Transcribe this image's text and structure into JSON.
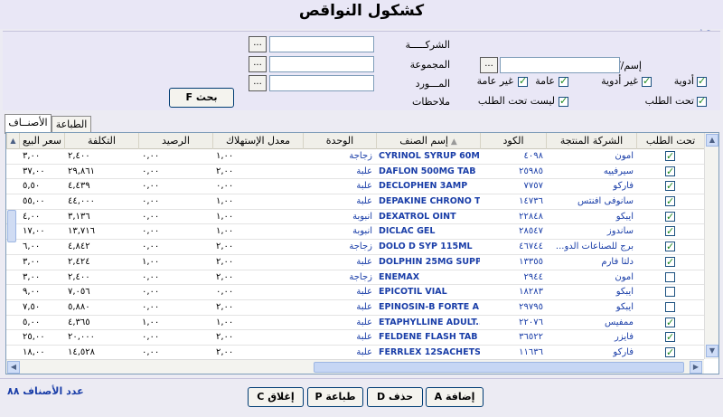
{
  "window": {
    "title": "كشكول النواقص"
  },
  "search": {
    "caption": "بحث",
    "company_label": "الشركـــــة",
    "group_label": "المجموعة",
    "supplier_label": "المـــورد",
    "notes_label": "ملاحظات",
    "item_label": "إسم/كود الصنف",
    "company_value": "",
    "group_value": "",
    "supplier_value": "",
    "item_value": "",
    "dots": "...",
    "search_button": "بحث F",
    "checks": {
      "medicines": {
        "label": "أدوية",
        "checked": true
      },
      "non_medicines": {
        "label": "غير أدوية",
        "checked": true
      },
      "public": {
        "label": "عامة",
        "checked": true
      },
      "non_public": {
        "label": "غير عامة",
        "checked": true
      },
      "on_order": {
        "label": "تحت الطلب",
        "checked": true
      },
      "not_on_order": {
        "label": "ليست تحت الطلب",
        "checked": true
      }
    }
  },
  "tabs": [
    {
      "label": "الأصنــاف",
      "active": true
    },
    {
      "label": "الطباعة",
      "active": false
    }
  ],
  "grid": {
    "columns": {
      "on_order": "تحت الطلب",
      "maker": "الشركة المنتجة",
      "code": "الكود",
      "name": "إسم الصنف",
      "unit": "الوحدة",
      "consumption": "معدل الإستهلاك",
      "balance": "الرصيد",
      "cost": "التكلفة",
      "price": "سعر البيع"
    },
    "rows": [
      {
        "checked": true,
        "maker": "امون",
        "code": "٤٠٩٨",
        "name": "CYRINOL SYRUP 60ML",
        "unit": "زجاجة",
        "consumption": "١,٠٠",
        "balance": "٠,٠٠",
        "cost": "٢,٤٠٠",
        "price": "٣,٠٠"
      },
      {
        "checked": true,
        "maker": "سيرفييه",
        "code": "٢٥٩٨٥",
        "name": "DAFLON 500MG TAB",
        "unit": "علبة",
        "consumption": "٢,٠٠",
        "balance": "٠,٠٠",
        "cost": "٢٩,٨٦١",
        "price": "٣٧,٠٠"
      },
      {
        "checked": true,
        "maker": "فاركو",
        "code": "٧٧٥٧",
        "name": "DECLOPHEN 3AMP",
        "unit": "علبة",
        "consumption": "٠,٠٠",
        "balance": "٠,٠٠",
        "cost": "٤,٤٣٩",
        "price": "٥,٥٠"
      },
      {
        "checked": true,
        "maker": "سانوفى افنتس",
        "code": "١٤٧٣٦",
        "name": "DEPAKINE CHRONO T...",
        "unit": "علبة",
        "consumption": "١,٠٠",
        "balance": "٠,٠٠",
        "cost": "٤٤,٠٠٠",
        "price": "٥٥,٠٠"
      },
      {
        "checked": true,
        "maker": "ايبكو",
        "code": "٢٢٨٤٨",
        "name": "DEXATROL OINT",
        "unit": "انبوبة",
        "consumption": "١,٠٠",
        "balance": "٠,٠٠",
        "cost": "٣,١٣٦",
        "price": "٤,٠٠"
      },
      {
        "checked": true,
        "maker": "ساندوز",
        "code": "٢٨٥٤٧",
        "name": "DICLAC GEL",
        "unit": "انبوبة",
        "consumption": "١,٠٠",
        "balance": "٠,٠٠",
        "cost": "١٣,٧١٦",
        "price": "١٧,٠٠"
      },
      {
        "checked": true,
        "maker": "برج للصناعات الدو...",
        "code": "٤٦٧٤٤",
        "name": "DOLO D SYP 115ML",
        "unit": "زجاجة",
        "consumption": "٢,٠٠",
        "balance": "٠,٠٠",
        "cost": "٤,٨٤٢",
        "price": "٦,٠٠"
      },
      {
        "checked": true,
        "maker": "دلتا فارم",
        "code": "١٣٣٥٥",
        "name": "DOLPHIN 25MG SUPP",
        "unit": "علبة",
        "consumption": "٢,٠٠",
        "balance": "١,٠٠",
        "cost": "٢,٤٢٤",
        "price": "٣,٠٠"
      },
      {
        "checked": false,
        "maker": "امون",
        "code": "٢٩٤٤",
        "name": "ENEMAX",
        "unit": "زجاجة",
        "consumption": "٢,٠٠",
        "balance": "٠,٠٠",
        "cost": "٢,٤٠٠",
        "price": "٣,٠٠"
      },
      {
        "checked": false,
        "maker": "ايبكو",
        "code": "١٨٢٨٣",
        "name": "EPICOTIL VIAL",
        "unit": "علبة",
        "consumption": "٠,٠٠",
        "balance": "٠,٠٠",
        "cost": "٧,٠٥٦",
        "price": "٩,٠٠"
      },
      {
        "checked": false,
        "maker": "ايبكو",
        "code": "٢٩٧٩٥",
        "name": "EPINOSIN-B FORTE A...",
        "unit": "علبة",
        "consumption": "٢,٠٠",
        "balance": "٠,٠٠",
        "cost": "٥,٨٨٠",
        "price": "٧,٥٠"
      },
      {
        "checked": true,
        "maker": "ممفيس",
        "code": "٢٢٠٧٦",
        "name": "ETAPHYLLINE ADULT...",
        "unit": "علبة",
        "consumption": "١,٠٠",
        "balance": "١,٠٠",
        "cost": "٤,٣٦٥",
        "price": "٥,٠٠"
      },
      {
        "checked": true,
        "maker": "فايزر",
        "code": "٣٦٥٢٢",
        "name": "FELDENE FLASH TAB",
        "unit": "علبة",
        "consumption": "٢,٠٠",
        "balance": "٠,٠٠",
        "cost": "٢٠,٠٠٠",
        "price": "٢٥,٠٠"
      },
      {
        "checked": true,
        "maker": "فاركو",
        "code": "١١٦٣٦",
        "name": "FERRLEX 12SACHETS",
        "unit": "علبة",
        "consumption": "٢,٠٠",
        "balance": "٠,٠٠",
        "cost": "١٤,٥٢٨",
        "price": "١٨,٠٠"
      }
    ]
  },
  "footer": {
    "count_label": "عدد الأصناف",
    "count_value": "٨٨",
    "add": "إضافة A",
    "delete": "حذف D",
    "print": "طباعة P",
    "close": "إغلاق C"
  }
}
